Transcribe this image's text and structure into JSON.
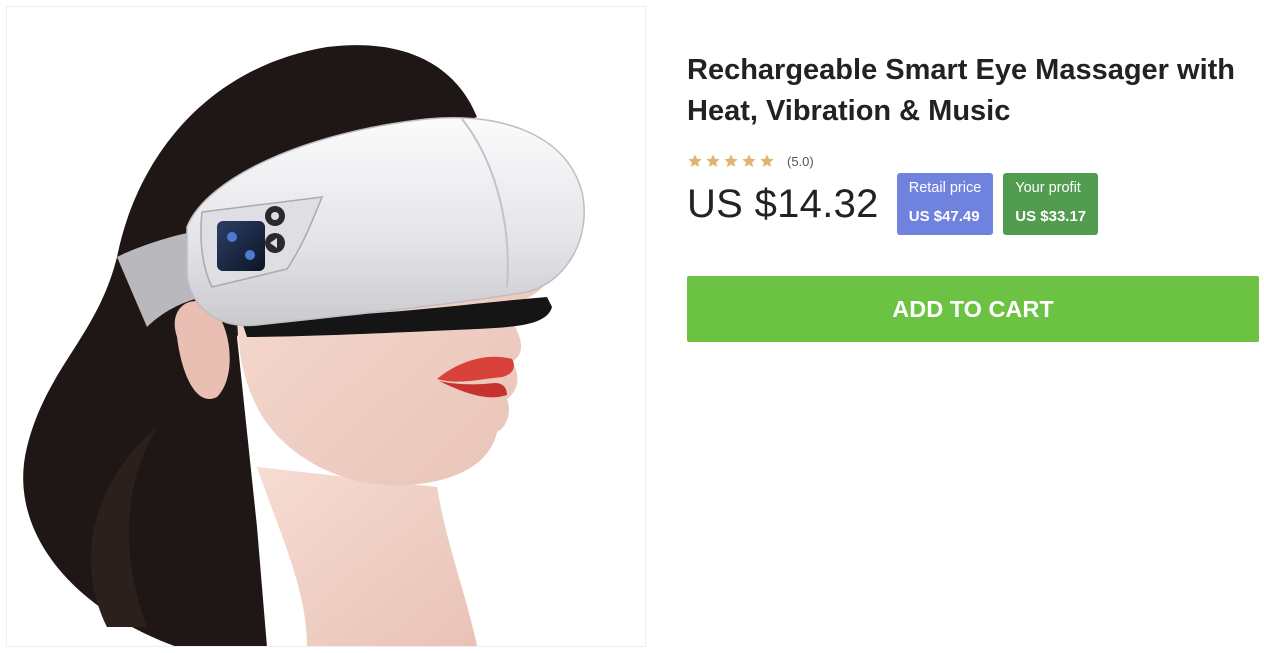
{
  "product": {
    "title": "Rechargeable Smart Eye Massager with Heat, Vibration & Music",
    "rating_stars": 5,
    "rating_text": "(5.0)",
    "price": "US $14.32",
    "retail_label": "Retail price",
    "retail_value": "US $47.49",
    "profit_label": "Your profit",
    "profit_value": "US $33.17",
    "add_to_cart_label": "ADD TO CART"
  },
  "colors": {
    "star": "#e0b46e",
    "retail_badge": "#6f82de",
    "profit_badge": "#519c4f",
    "cart_button": "#6cc242"
  },
  "image": {
    "icon": "product-photo-eye-massager"
  }
}
